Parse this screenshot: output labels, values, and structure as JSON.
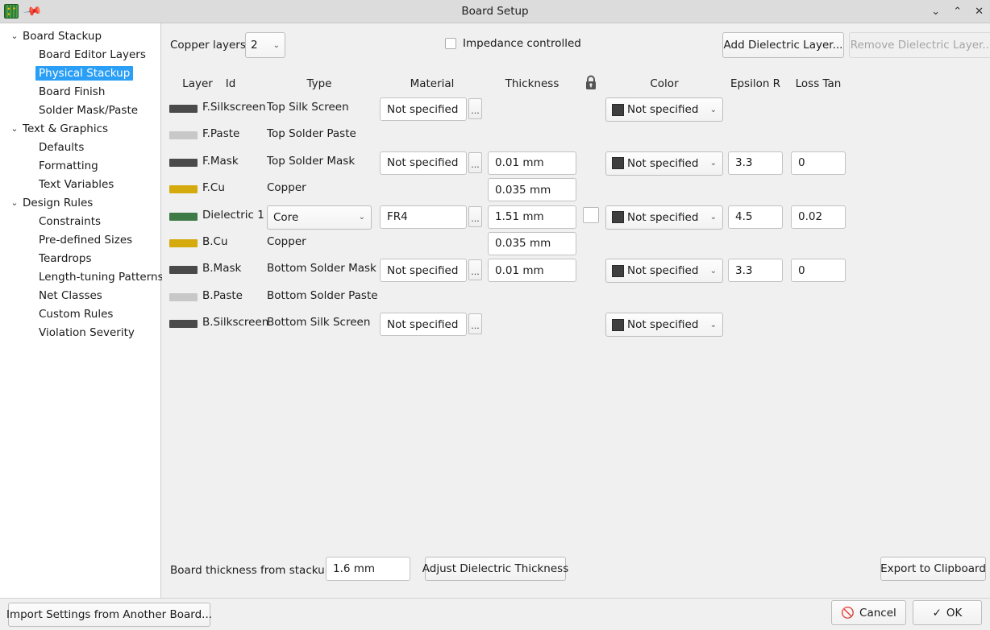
{
  "window": {
    "title": "Board Setup",
    "icon": "kicad-pcb-icon",
    "pin_icon": "pin-icon",
    "controls": {
      "minimize": "⌄",
      "maximize": "⌃",
      "close": "✕"
    }
  },
  "sidebar": {
    "items": [
      {
        "label": "Board Stackup",
        "level": 0,
        "chevron": "⌄",
        "selected": false
      },
      {
        "label": "Board Editor Layers",
        "level": 1,
        "chevron": "",
        "selected": false
      },
      {
        "label": "Physical Stackup",
        "level": 1,
        "chevron": "",
        "selected": true
      },
      {
        "label": "Board Finish",
        "level": 1,
        "chevron": "",
        "selected": false
      },
      {
        "label": "Solder Mask/Paste",
        "level": 1,
        "chevron": "",
        "selected": false
      },
      {
        "label": "Text & Graphics",
        "level": 0,
        "chevron": "⌄",
        "selected": false
      },
      {
        "label": "Defaults",
        "level": 1,
        "chevron": "",
        "selected": false
      },
      {
        "label": "Formatting",
        "level": 1,
        "chevron": "",
        "selected": false
      },
      {
        "label": "Text Variables",
        "level": 1,
        "chevron": "",
        "selected": false
      },
      {
        "label": "Design Rules",
        "level": 0,
        "chevron": "⌄",
        "selected": false
      },
      {
        "label": "Constraints",
        "level": 1,
        "chevron": "",
        "selected": false
      },
      {
        "label": "Pre-defined Sizes",
        "level": 1,
        "chevron": "",
        "selected": false
      },
      {
        "label": "Teardrops",
        "level": 1,
        "chevron": "",
        "selected": false
      },
      {
        "label": "Length-tuning Patterns",
        "level": 1,
        "chevron": "",
        "selected": false
      },
      {
        "label": "Net Classes",
        "level": 1,
        "chevron": "",
        "selected": false
      },
      {
        "label": "Custom Rules",
        "level": 1,
        "chevron": "",
        "selected": false
      },
      {
        "label": "Violation Severity",
        "level": 1,
        "chevron": "",
        "selected": false
      }
    ]
  },
  "toolbar": {
    "copper_layers_label": "Copper layers:",
    "copper_layers_value": "2",
    "impedance_label": "Impedance controlled",
    "impedance_checked": false,
    "add_dielectric_label": "Add Dielectric Layer...",
    "remove_dielectric_label": "Remove Dielectric Layer...",
    "remove_dielectric_enabled": false
  },
  "table": {
    "headers": {
      "layer": "Layer",
      "id": "Id",
      "type": "Type",
      "material": "Material",
      "thickness": "Thickness",
      "lock": "lock-icon",
      "color": "Color",
      "epsilon": "Epsilon R",
      "loss": "Loss Tan"
    },
    "rows": [
      {
        "swatch": "#4a4a4a",
        "id": "F.Silkscreen",
        "type_text": "Top Silk Screen",
        "type_combo": null,
        "material": "Not specified",
        "thickness": null,
        "lock": false,
        "color": "Not specified",
        "color_chip": "#3f3f3f",
        "epsilon": null,
        "loss": null
      },
      {
        "swatch": "#c8c8c8",
        "id": "F.Paste",
        "type_text": "Top Solder Paste",
        "type_combo": null,
        "material": null,
        "thickness": null,
        "lock": false,
        "color": null,
        "color_chip": null,
        "epsilon": null,
        "loss": null
      },
      {
        "swatch": "#4a4a4a",
        "id": "F.Mask",
        "type_text": "Top Solder Mask",
        "type_combo": null,
        "material": "Not specified",
        "thickness": "0.01 mm",
        "lock": false,
        "color": "Not specified",
        "color_chip": "#3f3f3f",
        "epsilon": "3.3",
        "loss": "0"
      },
      {
        "swatch": "#d4aa0d",
        "id": "F.Cu",
        "type_text": "Copper",
        "type_combo": null,
        "material": null,
        "thickness": "0.035 mm",
        "lock": false,
        "color": null,
        "color_chip": null,
        "epsilon": null,
        "loss": null
      },
      {
        "swatch": "#3e7a45",
        "id": "Dielectric 1",
        "type_text": null,
        "type_combo": "Core",
        "material": "FR4",
        "thickness": "1.51 mm",
        "lock": true,
        "color": "Not specified",
        "color_chip": "#3f3f3f",
        "epsilon": "4.5",
        "loss": "0.02"
      },
      {
        "swatch": "#d4aa0d",
        "id": "B.Cu",
        "type_text": "Copper",
        "type_combo": null,
        "material": null,
        "thickness": "0.035 mm",
        "lock": false,
        "color": null,
        "color_chip": null,
        "epsilon": null,
        "loss": null
      },
      {
        "swatch": "#4a4a4a",
        "id": "B.Mask",
        "type_text": "Bottom Solder Mask",
        "type_combo": null,
        "material": "Not specified",
        "thickness": "0.01 mm",
        "lock": false,
        "color": "Not specified",
        "color_chip": "#3f3f3f",
        "epsilon": "3.3",
        "loss": "0"
      },
      {
        "swatch": "#c8c8c8",
        "id": "B.Paste",
        "type_text": "Bottom Solder Paste",
        "type_combo": null,
        "material": null,
        "thickness": null,
        "lock": false,
        "color": null,
        "color_chip": null,
        "epsilon": null,
        "loss": null
      },
      {
        "swatch": "#4a4a4a",
        "id": "B.Silkscreen",
        "type_text": "Bottom Silk Screen",
        "type_combo": null,
        "material": "Not specified",
        "thickness": null,
        "lock": false,
        "color": "Not specified",
        "color_chip": "#3f3f3f",
        "epsilon": null,
        "loss": null
      }
    ],
    "ellipsis_label": "..."
  },
  "bottom": {
    "board_thickness_label": "Board thickness from stackup:",
    "board_thickness_value": "1.6 mm",
    "adjust_label": "Adjust Dielectric Thickness",
    "export_label": "Export to Clipboard"
  },
  "footer": {
    "import_label": "Import Settings from Another Board...",
    "cancel_label": "Cancel",
    "cancel_icon": "🚫",
    "ok_label": "OK",
    "ok_icon": "✓"
  },
  "colors": {
    "accent": "#2a9ff5",
    "panel_bg": "#f0f0f0",
    "sidebar_bg": "#ffffff",
    "titlebar_bg": "#dcdcdc"
  }
}
